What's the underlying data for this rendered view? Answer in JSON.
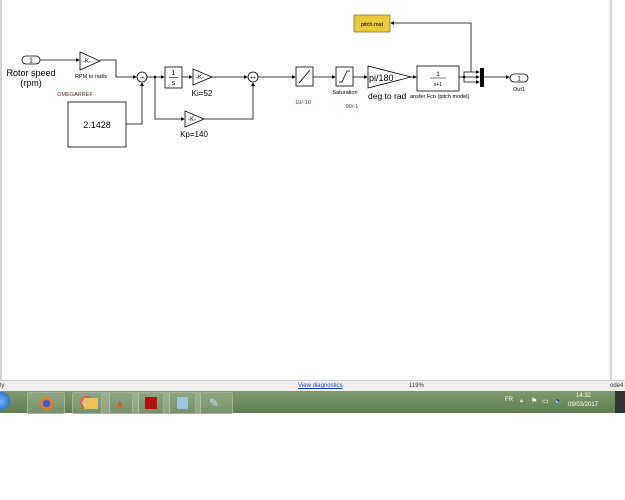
{
  "diagram": {
    "inport": {
      "number": "1",
      "label_line1": "Rotor speed",
      "label_line2": "(rpm)"
    },
    "rpm_gain": {
      "text": "-K-",
      "label": "RPM to rad/s"
    },
    "constant": {
      "name": "OMEGARREF",
      "value": "2.1428"
    },
    "sum1": {
      "signs": "-+"
    },
    "integrator": {
      "num": "1",
      "den": "s"
    },
    "ki_gain": {
      "text": "-K-",
      "label": "Ki=52"
    },
    "kp_gain": {
      "text": "-K-",
      "label": "Kp=140"
    },
    "sum2": {
      "signs": "++"
    },
    "rate_limiter": {
      "label": "10/-10"
    },
    "saturation": {
      "label": "Saturation",
      "limits": "90/-1"
    },
    "deg_gain": {
      "text": "pi/180",
      "label": "deg to rad"
    },
    "transfer_fcn": {
      "num": "1",
      "den": "s+1",
      "label": "ansfer Fcn (pitch model)"
    },
    "to_file": {
      "label": "pitch.mat",
      "color": "#e8c93a"
    },
    "outport": {
      "number": "1",
      "label": "Out1"
    }
  },
  "statusbar": {
    "left": "ly",
    "diagnostics": "View diagnostics",
    "zoom": "119%",
    "solver": "ode4"
  },
  "taskbar": {
    "apps": [
      "windows-start",
      "firefox",
      "chrome",
      "file-explorer",
      "matlab",
      "acrobat-reader",
      "notepad",
      "paint"
    ],
    "language": "FR",
    "time": "14:32",
    "date": "09/03/2017"
  }
}
